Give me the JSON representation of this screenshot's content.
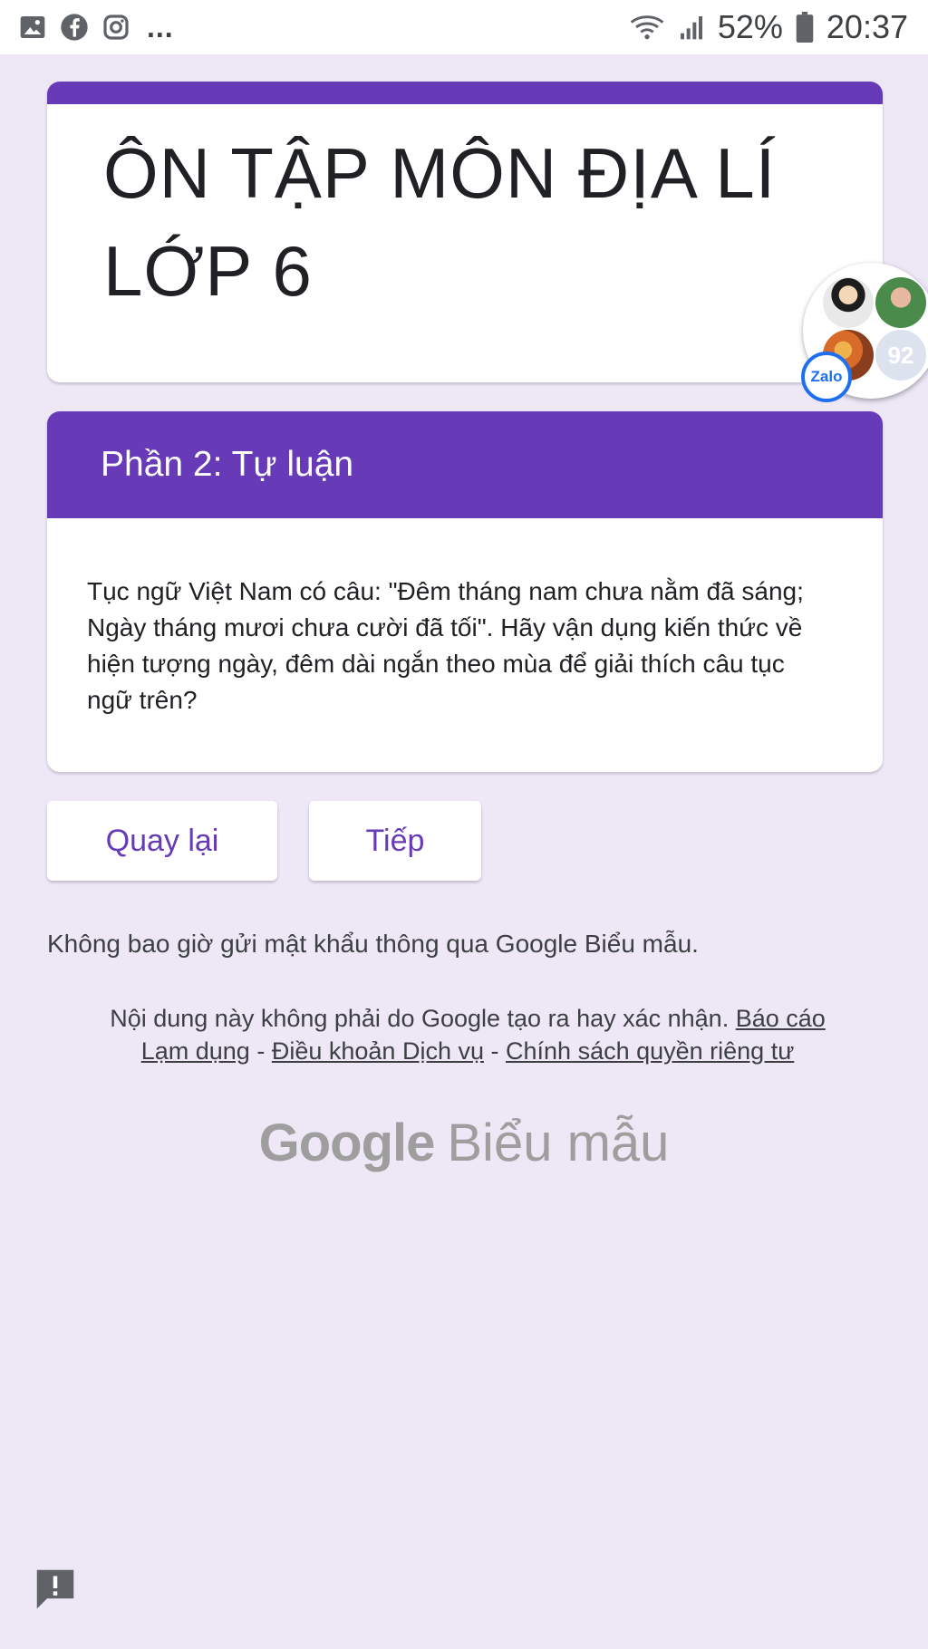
{
  "status_bar": {
    "icons_left": [
      "gallery-icon",
      "facebook-icon",
      "instagram-icon"
    ],
    "more": "...",
    "battery": "52%",
    "time": "20:37"
  },
  "form": {
    "title": "ÔN TẬP MÔN ĐỊA LÍ LỚP 6",
    "section_title": "Phần 2: Tự luận",
    "section_description": "Tục ngữ Việt Nam có câu: \"Đêm tháng nam chưa nằm đã sáng; Ngày tháng mươi chưa cười đã tối\". Hãy vận dụng kiến thức về hiện tượng ngày, đêm dài ngắn theo mùa để giải thích câu tục ngữ trên?",
    "back_label": "Quay lại",
    "next_label": "Tiếp"
  },
  "footer": {
    "password_warning": "Không bao giờ gửi mật khẩu thông qua Google Biểu mẫu.",
    "disclaimer": "Nội dung này không phải do Google tạo ra hay xác nhận.",
    "report_link": "Báo cáo Lạm dụng",
    "separator": "-",
    "terms_link": "Điều khoản Dịch vụ",
    "privacy_link": "Chính sách quyền riêng tư",
    "logo_brand": "Google",
    "logo_product": "Biểu mẫu"
  },
  "zalo": {
    "badge_label": "Zalo",
    "count": "92"
  },
  "colors": {
    "accent": "#673ab7",
    "background": "#ede7f6"
  }
}
